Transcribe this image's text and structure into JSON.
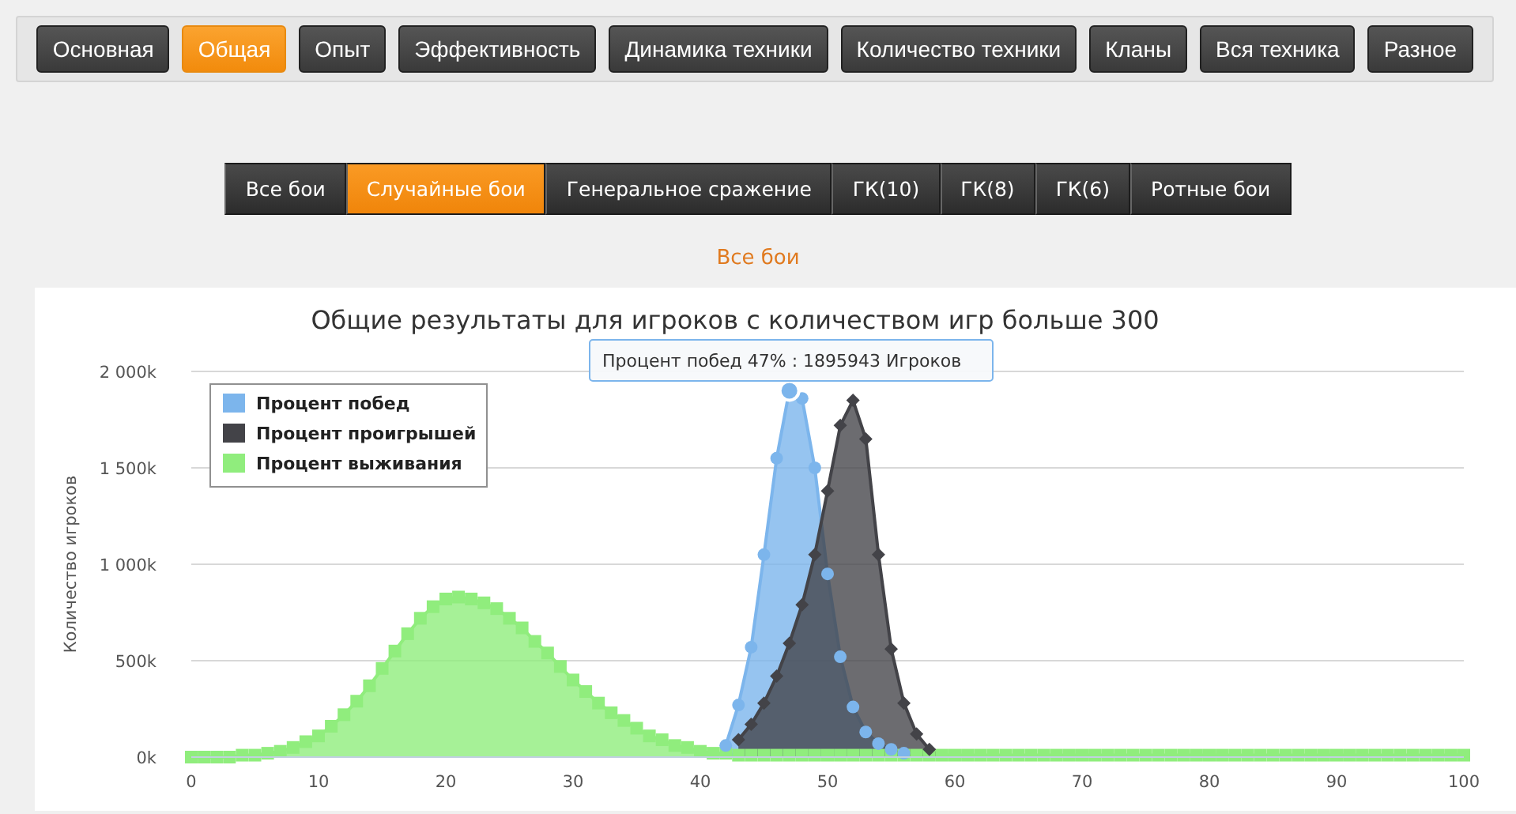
{
  "top_nav": [
    {
      "label": "Основная",
      "selected": false
    },
    {
      "label": "Общая",
      "selected": true
    },
    {
      "label": "Опыт",
      "selected": false
    },
    {
      "label": "Эффективность",
      "selected": false
    },
    {
      "label": "Динамика техники",
      "selected": false
    },
    {
      "label": "Количество техники",
      "selected": false
    },
    {
      "label": "Кланы",
      "selected": false
    },
    {
      "label": "Вся техника",
      "selected": false
    },
    {
      "label": "Разное",
      "selected": false
    }
  ],
  "battle_tabs": [
    {
      "label": "Все бои",
      "selected": false
    },
    {
      "label": "Случайные бои",
      "selected": true
    },
    {
      "label": "Генеральное сражение",
      "selected": false
    },
    {
      "label": "ГК(10)",
      "selected": false
    },
    {
      "label": "ГК(8)",
      "selected": false
    },
    {
      "label": "ГК(6)",
      "selected": false
    },
    {
      "label": "Ротные бои",
      "selected": false
    }
  ],
  "filter_link": "Все бои",
  "chart": {
    "tooltip": "Процент побед 47% : 1895943 Игроков",
    "chart_data": {
      "type": "area",
      "title": "Общие результаты для игроков с количеством игр больше 300",
      "ylabel": "Количество игроков",
      "xlim": [
        0,
        100
      ],
      "ylim": [
        0,
        2000
      ],
      "xticks": [
        0,
        10,
        20,
        30,
        40,
        50,
        60,
        70,
        80,
        90,
        100
      ],
      "yticks": [
        {
          "value": 0,
          "label": "0k"
        },
        {
          "value": 500,
          "label": "500k"
        },
        {
          "value": 1000,
          "label": "1 000k"
        },
        {
          "value": 1500,
          "label": "1 500k"
        },
        {
          "value": 2000,
          "label": "2 000k"
        }
      ],
      "x": [
        0,
        1,
        2,
        3,
        4,
        5,
        6,
        7,
        8,
        9,
        10,
        11,
        12,
        13,
        14,
        15,
        16,
        17,
        18,
        19,
        20,
        21,
        22,
        23,
        24,
        25,
        26,
        27,
        28,
        29,
        30,
        31,
        32,
        33,
        34,
        35,
        36,
        37,
        38,
        39,
        40,
        41,
        42,
        43,
        44,
        45,
        46,
        47,
        48,
        49,
        50,
        51,
        52,
        53,
        54,
        55,
        56,
        57,
        58,
        59,
        60,
        61,
        62,
        63,
        64,
        65,
        66,
        67,
        68,
        69,
        70,
        71,
        72,
        73,
        74,
        75,
        76,
        77,
        78,
        79,
        80,
        81,
        82,
        83,
        84,
        85,
        86,
        87,
        88,
        89,
        90,
        91,
        92,
        93,
        94,
        95,
        96,
        97,
        98,
        99,
        100
      ],
      "series": [
        {
          "name": "Процент побед",
          "color": "#7cb5ec",
          "values": [
            null,
            null,
            null,
            null,
            null,
            null,
            null,
            null,
            null,
            null,
            null,
            null,
            null,
            null,
            null,
            null,
            null,
            null,
            null,
            null,
            null,
            null,
            null,
            null,
            null,
            null,
            null,
            null,
            null,
            null,
            null,
            null,
            null,
            null,
            null,
            null,
            null,
            null,
            null,
            null,
            null,
            null,
            60,
            270,
            570,
            1050,
            1550,
            1900,
            1860,
            1500,
            950,
            520,
            260,
            130,
            70,
            40,
            20,
            null,
            null,
            null,
            null,
            null,
            null,
            null,
            null,
            null,
            null,
            null,
            null,
            null,
            null,
            null,
            null,
            null,
            null,
            null,
            null,
            null,
            null,
            null,
            null,
            null,
            null,
            null,
            null,
            null,
            null,
            null,
            null,
            null,
            null,
            null,
            null,
            null,
            null,
            null,
            null,
            null,
            null,
            null,
            null
          ]
        },
        {
          "name": "Процент проигрышей",
          "color": "#434348",
          "values": [
            null,
            null,
            null,
            null,
            null,
            null,
            null,
            null,
            null,
            null,
            null,
            null,
            null,
            null,
            null,
            null,
            null,
            null,
            null,
            null,
            null,
            null,
            null,
            null,
            null,
            null,
            null,
            null,
            null,
            null,
            null,
            null,
            null,
            null,
            null,
            null,
            null,
            null,
            null,
            null,
            null,
            null,
            null,
            90,
            170,
            280,
            420,
            590,
            790,
            1050,
            1380,
            1720,
            1850,
            1650,
            1050,
            560,
            280,
            120,
            40,
            0,
            null,
            null,
            null,
            null,
            null,
            null,
            null,
            null,
            null,
            null,
            null,
            null,
            null,
            null,
            null,
            null,
            null,
            null,
            null,
            null,
            null,
            null,
            null,
            null,
            null,
            null,
            null,
            null,
            null,
            null,
            null,
            null,
            null,
            null,
            null,
            null,
            null,
            null,
            null,
            null,
            null
          ]
        },
        {
          "name": "Процент выживания",
          "color": "#90ed7d",
          "values": [
            0,
            0,
            0,
            0,
            10,
            10,
            20,
            30,
            50,
            80,
            110,
            160,
            220,
            290,
            370,
            460,
            550,
            640,
            720,
            780,
            820,
            830,
            820,
            800,
            770,
            720,
            670,
            600,
            540,
            470,
            400,
            340,
            280,
            230,
            190,
            150,
            110,
            90,
            60,
            50,
            30,
            20,
            20,
            10,
            10,
            10,
            10,
            10,
            10,
            10,
            10,
            10,
            10,
            10,
            10,
            10,
            10,
            10,
            10,
            10,
            10,
            10,
            10,
            10,
            10,
            10,
            10,
            10,
            10,
            10,
            10,
            10,
            10,
            10,
            10,
            10,
            10,
            10,
            10,
            10,
            10,
            10,
            10,
            10,
            10,
            10,
            10,
            10,
            10,
            10,
            10,
            10,
            10,
            10,
            10,
            10,
            10,
            10,
            10,
            10,
            10
          ]
        }
      ],
      "grid": true,
      "legend": true
    }
  }
}
